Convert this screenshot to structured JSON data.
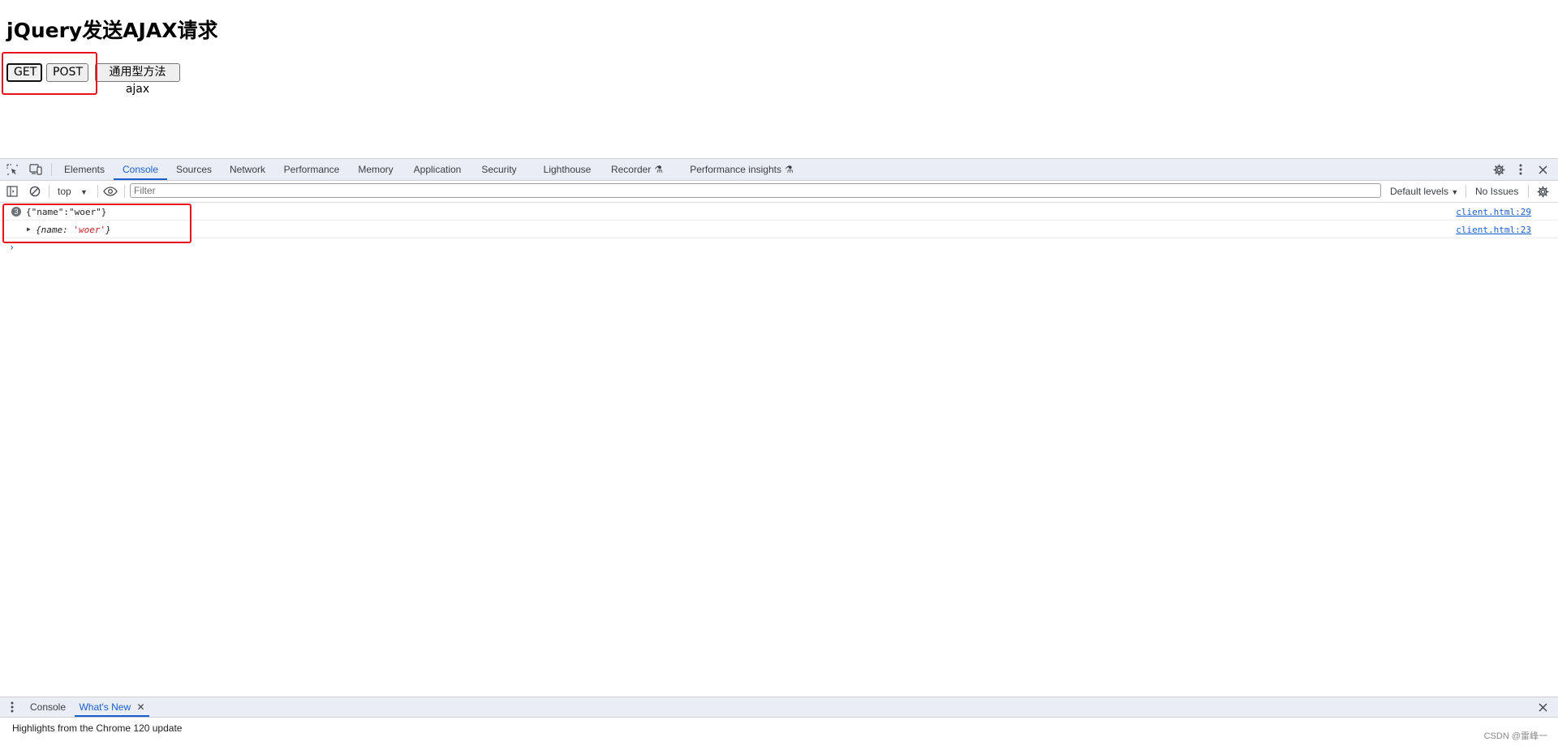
{
  "page": {
    "heading": "jQuery发送AJAX请求",
    "buttons": {
      "get": "GET",
      "post": "POST",
      "ajax": "通用型方法ajax"
    }
  },
  "devtools": {
    "tabs": [
      "Elements",
      "Console",
      "Sources",
      "Network",
      "Performance",
      "Memory",
      "Application",
      "Security",
      "Lighthouse",
      "Recorder",
      "Performance insights"
    ],
    "active_tab": "Console",
    "toolbar": {
      "context": "top",
      "filter_placeholder": "Filter",
      "default_levels": "Default levels",
      "issues": "No Issues"
    },
    "console_messages": [
      {
        "count": "3",
        "text": "{\"name\":\"woer\"}",
        "source": "client.html:29"
      },
      {
        "object_key": "name",
        "object_value": "'woer'",
        "source": "client.html:23"
      }
    ],
    "drawer": {
      "tabs": [
        "Console",
        "What's New"
      ],
      "active_tab": "What's New",
      "content": "Highlights from the Chrome 120 update"
    }
  },
  "watermark": "CSDN @雷峰一"
}
